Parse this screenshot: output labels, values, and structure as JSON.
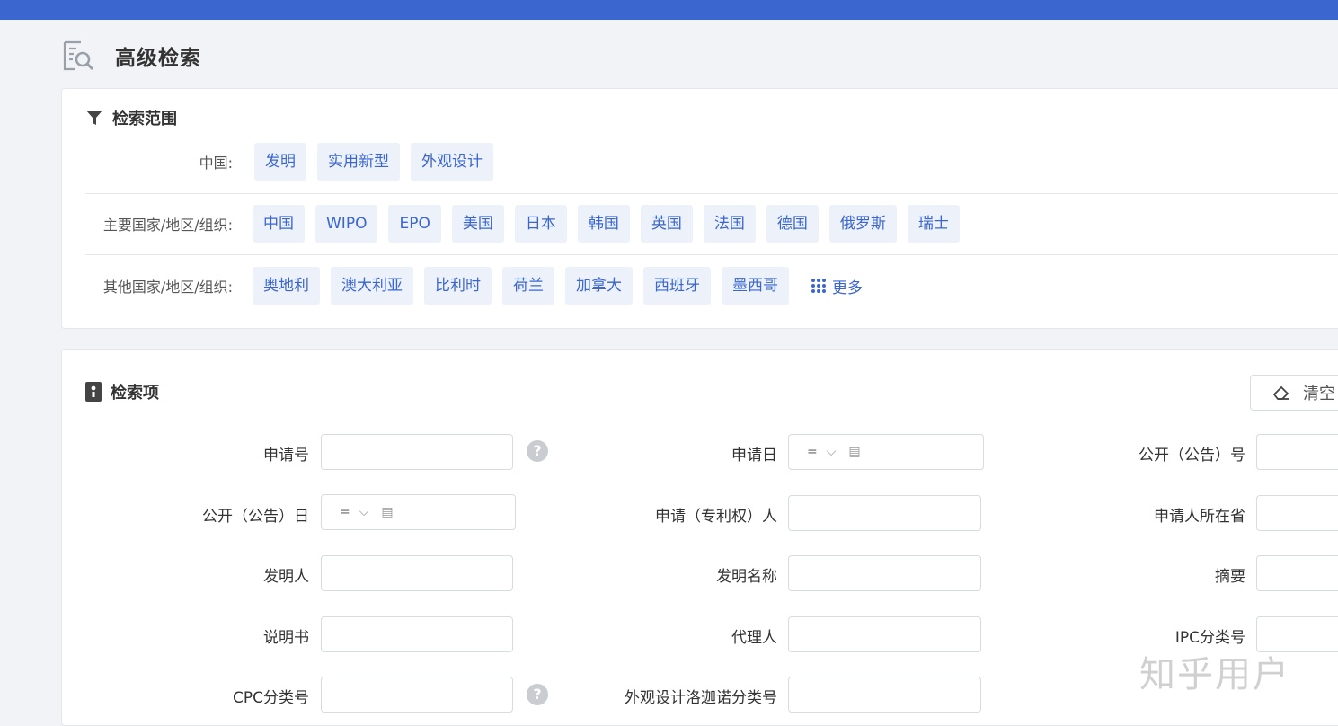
{
  "page": {
    "title": "高级检索"
  },
  "scope": {
    "title": "检索范围",
    "rows": [
      {
        "label": "中国:",
        "chips": [
          "发明",
          "实用新型",
          "外观设计"
        ]
      },
      {
        "label": "主要国家/地区/组织:",
        "chips": [
          "中国",
          "WIPO",
          "EPO",
          "美国",
          "日本",
          "韩国",
          "英国",
          "法国",
          "德国",
          "俄罗斯",
          "瑞士"
        ]
      },
      {
        "label": "其他国家/地区/组织:",
        "chips": [
          "奥地利",
          "澳大利亚",
          "比利时",
          "荷兰",
          "加拿大",
          "西班牙",
          "墨西哥"
        ],
        "more_label": "更多"
      }
    ]
  },
  "search_items": {
    "title": "检索项",
    "clear_label": "清空",
    "date_operator": "=",
    "fields": {
      "application_no": "申请号",
      "application_date": "申请日",
      "publication_no": "公开（公告）号",
      "publication_date": "公开（公告）日",
      "applicant": "申请（专利权）人",
      "applicant_province": "申请人所在省",
      "inventor": "发明人",
      "invention_title": "发明名称",
      "abstract": "摘要",
      "description": "说明书",
      "agent": "代理人",
      "ipc": "IPC分类号",
      "cpc": "CPC分类号",
      "locarno": "外观设计洛迦诺分类号"
    },
    "help_symbol": "?"
  },
  "watermark": "知乎用户",
  "colors": {
    "accent": "#3b66cf",
    "chip_bg": "#edf2fa",
    "background": "#f1f3f7"
  }
}
